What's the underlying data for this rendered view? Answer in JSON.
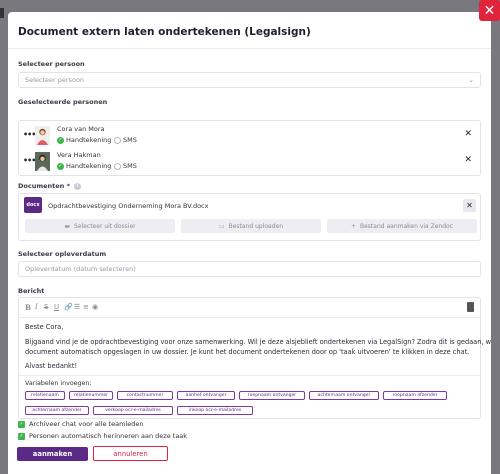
{
  "modal": {
    "title": "Document extern laten ondertekenen (Legalsign)",
    "close_icon": "close-icon"
  },
  "select_person": {
    "label": "Selecteer persoon",
    "placeholder": "Selecteer persoon"
  },
  "selected_persons": {
    "label": "Geselecteerde personen",
    "items": [
      {
        "name": "Cora van Mora",
        "opt_handwriting": "Handtekening",
        "opt_sms": "SMS",
        "handwriting_checked": true
      },
      {
        "name": "Vera Hakman",
        "opt_handwriting": "Handtekening",
        "opt_sms": "SMS",
        "handwriting_checked": true
      }
    ]
  },
  "documents": {
    "label": "Documenten",
    "required_marker": "*",
    "file_badge": "docx",
    "file_name": "Opdrachtbevestiging Onderneming Mora BV.docx",
    "buttons": {
      "select_from_file": "Selecteer uit dossier",
      "upload": "Bestand uploaden",
      "create_zendoc": "Bestand aanmaken via Zendoc"
    }
  },
  "delivery_date": {
    "label": "Selecteer opleverdatum",
    "placeholder": "Opleverdatum  (datum selecteren)"
  },
  "message": {
    "label": "Bericht",
    "toolbar": {
      "bold": "B",
      "italic": "I",
      "strike": "S",
      "underline": "U"
    },
    "lines": [
      "Beste Cora,",
      "Bijgaand vind je de opdrachtbevestiging voor onze samenwerking. Wil je deze alsjeblieft ondertekenen via LegalSign? Zodra dit is gedaan, wordt het",
      "document automatisch opgeslagen in uw dossier. Je kunt het document ondertekenen door op 'taak uitvoeren' te klikken in deze chat.",
      "Alvast bedankt!"
    ],
    "variables_label": "Variabelen invoegen:",
    "variables": [
      "relatienaam",
      "relatienummer",
      "contactnummer",
      "aanhef ontvanger",
      "roepnaam ontvanger",
      "achternaam ontvanger",
      "roepnaam afzender",
      "achternaam afzender",
      "verkoop ocr-e-mailadres",
      "inkoop ocr-e-mailadres"
    ]
  },
  "options": {
    "archive_chat": "Archiveer chat voor alle teamleden",
    "remind_persons": "Personen automatisch herinneren aan deze taak"
  },
  "actions": {
    "submit": "aanmaken",
    "cancel": "annuleren"
  },
  "colors": {
    "brand": "#5b2a86",
    "danger": "#e0243c",
    "success": "#3cb54a"
  }
}
